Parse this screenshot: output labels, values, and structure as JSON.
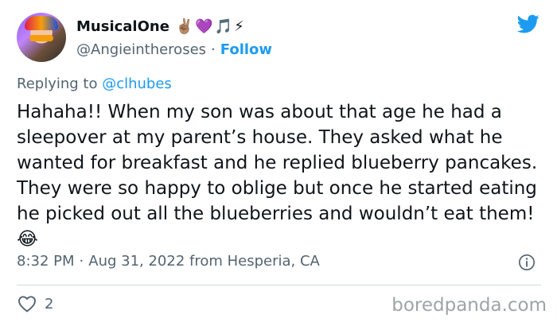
{
  "user": {
    "display_name": "MusicalOne",
    "name_emojis": "✌🏽💜🎵⚡",
    "handle": "@Angieintheroses",
    "separator": "·",
    "follow_label": "Follow"
  },
  "tweet": {
    "reply_prefix": "Replying to",
    "reply_mention": "@clhubes",
    "text": "Hahaha!! When my son was about that age he had a sleepover at my parent’s house. They asked what he wanted for breakfast and he replied blueberry pancakes. They were so happy to oblige but once he started eating he picked out all the blueberries and wouldn’t eat them! 😂",
    "time": "8:32 PM",
    "date_location": "Aug 31, 2022 from Hesperia, CA",
    "separator": "·",
    "like_count": "2"
  },
  "watermark": "boredpanda.com",
  "colors": {
    "accent": "#1d9bf0",
    "muted": "#536471",
    "text": "#0f1419"
  },
  "icons": [
    "twitter-bird-icon",
    "info-icon",
    "heart-icon"
  ]
}
